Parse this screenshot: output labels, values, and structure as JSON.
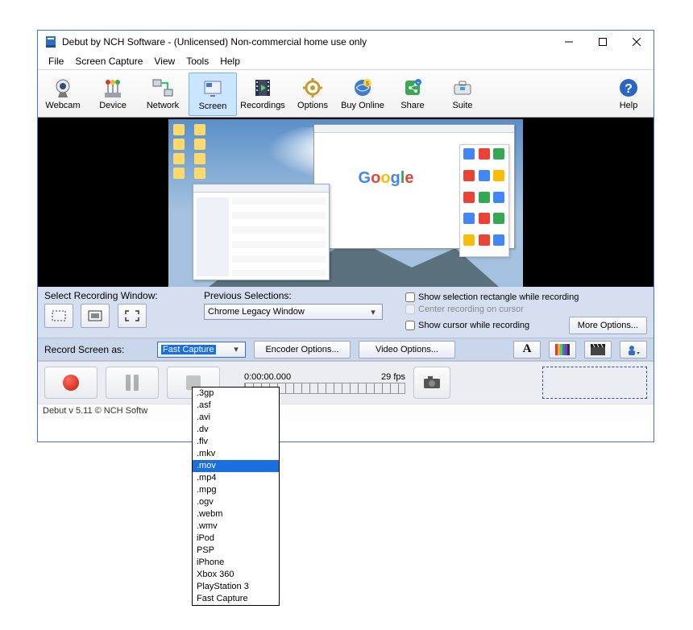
{
  "titlebar": {
    "title": "Debut by NCH Software - (Unlicensed) Non-commercial home use only"
  },
  "menu": {
    "file": "File",
    "screen_capture": "Screen Capture",
    "view": "View",
    "tools": "Tools",
    "help": "Help"
  },
  "toolbar": {
    "webcam": "Webcam",
    "device": "Device",
    "network": "Network",
    "screen": "Screen",
    "recordings": "Recordings",
    "options": "Options",
    "buy": "Buy Online",
    "share": "Share",
    "suite": "Suite",
    "help": "Help"
  },
  "sel_panel": {
    "label": "Select Recording Window:",
    "prev_label": "Previous Selections:",
    "prev_value": "Chrome Legacy Window",
    "chk_show_rect": "Show selection rectangle while recording",
    "chk_center": "Center recording on cursor",
    "chk_show_cursor": "Show cursor while recording",
    "more_options": "More Options..."
  },
  "rec_panel": {
    "label": "Record Screen as:",
    "format_value": "Fast Capture",
    "encoder_btn": "Encoder Options...",
    "video_btn": "Video Options..."
  },
  "transport": {
    "time": "0:00:00.000",
    "fps": "29 fps"
  },
  "statusbar": {
    "text": "Debut v 5.11 © NCH Softw"
  },
  "format_dropdown": {
    "items": [
      ".3gp",
      ".asf",
      ".avi",
      ".dv",
      ".flv",
      ".mkv",
      ".mov",
      ".mp4",
      ".mpg",
      ".ogv",
      ".webm",
      ".wmv",
      "iPod",
      "PSP",
      "iPhone",
      "Xbox 360",
      "PlayStation 3",
      "Fast Capture"
    ],
    "selected_index": 6
  },
  "preview": {
    "google": [
      "G",
      "o",
      "o",
      "g",
      "l",
      "e"
    ]
  }
}
